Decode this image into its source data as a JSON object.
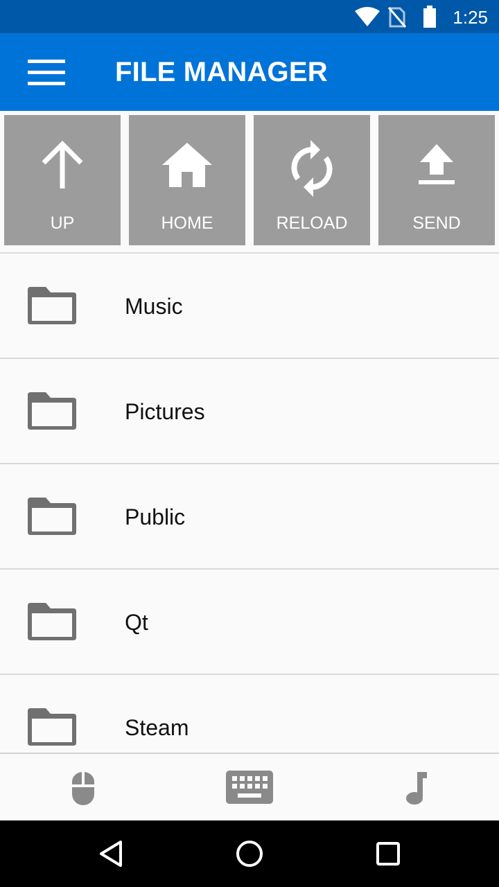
{
  "status_bar": {
    "time": "1:25",
    "icons": [
      "wifi-icon",
      "no-sim-icon",
      "battery-icon"
    ],
    "background": "#0058a8"
  },
  "app_bar": {
    "title": "FILE MANAGER",
    "menu_icon": "hamburger-menu-icon",
    "background": "#0073d9"
  },
  "toolbar": {
    "buttons": [
      {
        "label": "UP",
        "icon": "arrow-up-icon"
      },
      {
        "label": "HOME",
        "icon": "home-icon"
      },
      {
        "label": "RELOAD",
        "icon": "reload-icon"
      },
      {
        "label": "SEND",
        "icon": "upload-icon"
      }
    ],
    "button_color": "#9c9c9c"
  },
  "file_list": {
    "items": [
      {
        "name": "Music",
        "icon": "folder-icon"
      },
      {
        "name": "Pictures",
        "icon": "folder-icon"
      },
      {
        "name": "Public",
        "icon": "folder-icon"
      },
      {
        "name": "Qt",
        "icon": "folder-icon"
      },
      {
        "name": "Steam",
        "icon": "folder-icon"
      }
    ]
  },
  "bottom_tabs": {
    "icons": [
      "mouse-icon",
      "keyboard-icon",
      "music-note-icon"
    ],
    "icon_color": "#8a8a8a"
  },
  "nav_bar": {
    "icons": [
      "back-icon",
      "home-circle-icon",
      "recents-icon"
    ]
  }
}
